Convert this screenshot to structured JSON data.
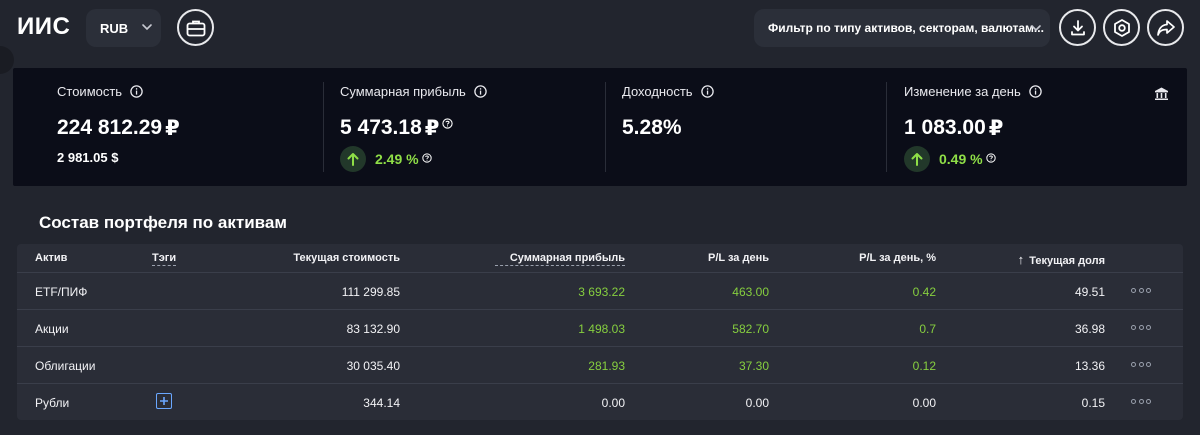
{
  "header": {
    "title": "ИИС",
    "currency": "RUB",
    "filter_placeholder": "Фильтр по типу активов, секторам, валютам..."
  },
  "summary": {
    "value": {
      "label": "Стоимость",
      "amount": "224 812.29",
      "currency": "₽",
      "usd": "2 981.05 $"
    },
    "total_profit": {
      "label": "Суммарная прибыль",
      "amount": "5 473.18",
      "currency": "₽",
      "change": "2.49 %"
    },
    "yield": {
      "label": "Доходность",
      "amount": "5.28%"
    },
    "day_change": {
      "label": "Изменение за день",
      "amount": "1 083.00",
      "currency": "₽",
      "change": "0.49 %"
    }
  },
  "portfolio": {
    "title": "Состав портфеля по активам",
    "columns": {
      "asset": "Актив",
      "tags": "Тэги",
      "current_value": "Текущая стоимость",
      "total_profit": "Суммарная прибыль",
      "pl_day": "P/L за день",
      "pl_day_pct": "P/L за день, %",
      "share": "Текущая доля",
      "sort_arrow": "↑"
    },
    "rows": [
      {
        "asset": "ETF/ПИФ",
        "current_value": "111 299.85",
        "total_profit": "3 693.22",
        "pl_day": "463.00",
        "pl_day_pct": "0.42",
        "share": "49.51"
      },
      {
        "asset": "Акции",
        "current_value": "83 132.90",
        "total_profit": "1 498.03",
        "pl_day": "582.70",
        "pl_day_pct": "0.7",
        "share": "36.98"
      },
      {
        "asset": "Облигации",
        "current_value": "30 035.40",
        "total_profit": "281.93",
        "pl_day": "37.30",
        "pl_day_pct": "0.12",
        "share": "13.36"
      },
      {
        "asset": "Рубли",
        "current_value": "344.14",
        "total_profit": "0.00",
        "pl_day": "0.00",
        "pl_day_pct": "0.00",
        "share": "0.15"
      }
    ]
  },
  "colors": {
    "background": "#22252e",
    "panel": "#0b0d18",
    "positive": "#86cf3f",
    "accent_blue": "#6aa7ff"
  },
  "icons": {
    "portfolio": "briefcase-icon",
    "download": "download-icon",
    "settings": "hexagon-settings-icon",
    "share": "share-icon",
    "bank": "bank-icon",
    "info": "info-icon",
    "help": "help-icon",
    "up": "arrow-up-icon",
    "more": "more-icon",
    "add_tag": "plus-square-icon"
  }
}
